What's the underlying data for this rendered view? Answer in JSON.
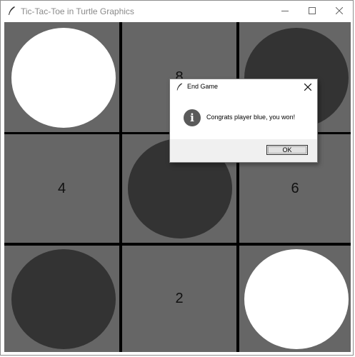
{
  "window": {
    "title": "Tic-Tac-Toe in Turtle Graphics",
    "icon": "feather-icon",
    "controls": [
      "minimize-icon",
      "maximize-icon",
      "close-icon"
    ]
  },
  "board": {
    "background_color": "#666666",
    "line_color": "#000000",
    "cells": [
      {
        "position": 7,
        "label": "",
        "piece": "white"
      },
      {
        "position": 8,
        "label": "8",
        "piece": ""
      },
      {
        "position": 9,
        "label": "",
        "piece": "dark"
      },
      {
        "position": 4,
        "label": "4",
        "piece": ""
      },
      {
        "position": 5,
        "label": "",
        "piece": "dark"
      },
      {
        "position": 6,
        "label": "6",
        "piece": ""
      },
      {
        "position": 1,
        "label": "",
        "piece": "dark"
      },
      {
        "position": 2,
        "label": "2",
        "piece": ""
      },
      {
        "position": 3,
        "label": "",
        "piece": "white"
      }
    ],
    "piece_colors": {
      "white": "#ffffff",
      "dark": "#333333"
    }
  },
  "dialog": {
    "title": "End Game",
    "icon": "info-icon",
    "icon_glyph": "i",
    "message": "Congrats player blue, you won!",
    "ok_label": "OK"
  }
}
